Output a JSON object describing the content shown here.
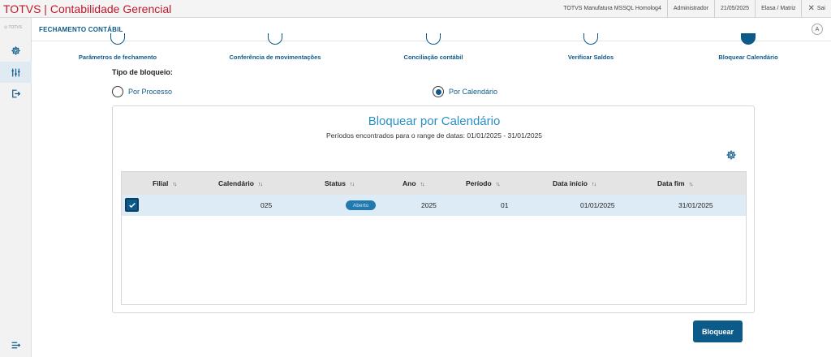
{
  "app": {
    "title": "TOTVS | Contabilidade Gerencial"
  },
  "topbar": {
    "environment": "TOTVS Manufatura MSSQL Homolog4",
    "user": "Administrador",
    "date": "21/05/2025",
    "branch": "Elasa / Matriz",
    "close_label": "Sai"
  },
  "sidebar": {
    "brand": "TOTVS"
  },
  "header": {
    "title": "FECHAMENTO CONTÁBIL",
    "avatar": "A"
  },
  "steps": [
    {
      "label": "Parâmetros de fechamento"
    },
    {
      "label": "Conferência de movimentações"
    },
    {
      "label": "Conciliação contábil"
    },
    {
      "label": "Verificar Saldos"
    },
    {
      "label": "Bloquear Calendário"
    }
  ],
  "lock_type": {
    "label": "Tipo de bloqueio:",
    "options": [
      {
        "label": "Por Processo",
        "selected": false
      },
      {
        "label": "Por Calendário",
        "selected": true
      }
    ]
  },
  "panel": {
    "title": "Bloquear por Calendário",
    "subtitle": "Períodos encontrados para o range de datas: 01/01/2025 - 31/01/2025"
  },
  "table": {
    "sort_glyph": "↑↓",
    "columns": [
      "Filial",
      "Calendário",
      "Status",
      "Ano",
      "Período",
      "Data início",
      "Data fim"
    ],
    "rows": [
      {
        "filial": "",
        "calendario": "025",
        "status": "Aberto",
        "ano": "2025",
        "periodo": "01",
        "data_inicio": "01/01/2025",
        "data_fim": "31/01/2025"
      }
    ]
  },
  "actions": {
    "block_label": "Bloquear"
  },
  "colors": {
    "brand_red": "#c0182b",
    "primary": "#0c5a8a",
    "title_blue": "#2a8fc7",
    "row_selected": "#dcebf6"
  }
}
